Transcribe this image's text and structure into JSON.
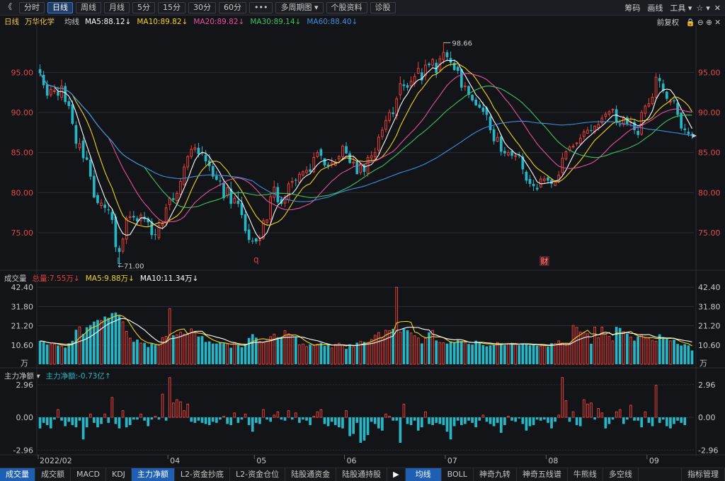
{
  "toolbar": {
    "back_glyph": "《",
    "tabs": [
      {
        "label": "分时",
        "active": false
      },
      {
        "label": "日线",
        "active": true
      },
      {
        "label": "周线",
        "active": false
      },
      {
        "label": "月线",
        "active": false
      },
      {
        "label": "5分",
        "active": false
      },
      {
        "label": "15分",
        "active": false
      },
      {
        "label": "30分",
        "active": false
      },
      {
        "label": "60分",
        "active": false
      },
      {
        "label": "•••",
        "active": false
      },
      {
        "label": "多周期图 ▾",
        "active": false
      },
      {
        "label": "个股资料",
        "active": false
      },
      {
        "label": "诊股",
        "active": false
      }
    ],
    "right": {
      "chips": "筹码",
      "draw": "画线",
      "tools": "工具 ▾",
      "star": "☆",
      "menu": "▾",
      "close": "✕"
    }
  },
  "price_legend": {
    "period": "日线",
    "stock": "万华化学",
    "ma_label": "均线",
    "ma5": "MA5:88.12↓",
    "ma10": "MA10:89.82↓",
    "ma20": "MA20:89.82↓",
    "ma30": "MA30:89.14↓",
    "ma60": "MA60:88.40↓",
    "adjust": "前复权",
    "icons": "🔒 ⊖ ⊕ ✕"
  },
  "volume_legend": {
    "title": "成交量",
    "total": "总量:7.55万↓",
    "ma5": "MA5:9.88万↓",
    "ma10": "MA10:11.34万↓"
  },
  "flow_legend": {
    "title": "主力净额 ▾",
    "value": "主力净额:-0.73亿↑"
  },
  "colors": {
    "up": "#e8403a",
    "down": "#27b6c6",
    "ma5": "#ffffff",
    "ma10": "#f2d21b",
    "ma20": "#e84f9e",
    "ma30": "#3cc25e",
    "ma60": "#3d8ee0",
    "axis": "#e04a45",
    "grid": "#2a2d33"
  },
  "chart_data": [
    {
      "type": "candlestick",
      "title": "万华化学 日线",
      "y_ticks": [
        95.0,
        90.0,
        85.0,
        80.0,
        75.0
      ],
      "y_tick_labels": [
        "95.00",
        "90.00",
        "85.00",
        "80.00",
        "75.00"
      ],
      "ylim": [
        70.5,
        100.5
      ],
      "annotations": {
        "high": "98.66",
        "low": "←71.00",
        "mark_L": "L",
        "mark_q": "q",
        "mark_cai": "财"
      },
      "x_tick_labels": [
        "2022/02",
        "04",
        "05",
        "06",
        "07",
        "08",
        "09"
      ],
      "x_tick_index": [
        0,
        36,
        60,
        85,
        113,
        141,
        169
      ],
      "ma_names": [
        "MA5",
        "MA10",
        "MA20",
        "MA30",
        "MA60"
      ],
      "close": [
        94.9,
        93.4,
        92.1,
        92.9,
        92.7,
        92.1,
        93.3,
        91.3,
        90.8,
        88.6,
        86.1,
        86.1,
        84.3,
        84.1,
        82.0,
        79.4,
        78.7,
        78.7,
        78.1,
        77.8,
        76.6,
        73.2,
        72.6,
        74.2,
        76.8,
        77.0,
        76.9,
        76.4,
        77.2,
        76.7,
        76.3,
        74.7,
        74.7,
        75.9,
        76.1,
        78.1,
        79.3,
        79.1,
        79.9,
        81.4,
        83.2,
        84.5,
        85.4,
        85.6,
        84.8,
        84.9,
        83.9,
        83.3,
        82.0,
        81.6,
        81.4,
        79.3,
        80.6,
        78.6,
        79.3,
        78.6,
        77.2,
        75.2,
        74.1,
        73.9,
        73.9,
        74.1,
        76.5,
        76.6,
        79.5,
        80.7,
        78.8,
        78.6,
        79.4,
        81.1,
        81.4,
        81.5,
        82.3,
        82.6,
        82.8,
        82.6,
        84.4,
        85.0,
        84.6,
        83.4,
        83.3,
        83.7,
        83.8,
        84.5,
        85.8,
        84.9,
        83.7,
        83.8,
        82.3,
        83.6,
        82.6,
        84.4,
        84.6,
        85.0,
        86.9,
        87.8,
        89.0,
        90.0,
        89.8,
        91.7,
        93.6,
        93.3,
        93.1,
        93.9,
        94.5,
        95.5,
        94.0,
        95.9,
        95.9,
        96.6,
        94.9,
        96.7,
        97.5,
        96.9,
        96.2,
        95.3,
        95.2,
        93.1,
        93.3,
        92.2,
        91.5,
        90.9,
        90.6,
        90.1,
        89.7,
        87.8,
        86.4,
        86.9,
        85.1,
        84.9,
        85.0,
        84.6,
        84.6,
        84.6,
        82.9,
        81.5,
        81.1,
        80.8,
        80.4,
        81.7,
        81.7,
        81.5,
        81.1,
        81.3,
        82.2,
        84.3,
        85.1,
        85.7,
        85.8,
        86.2,
        86.8,
        87.6,
        87.8,
        87.7,
        88.3,
        88.5,
        89.3,
        89.8,
        90.1,
        90.4,
        88.8,
        88.4,
        89.3,
        88.6,
        88.8,
        87.8,
        87.2,
        90.0,
        90.8,
        91.1,
        91.9,
        94.4,
        93.9,
        92.7,
        91.7,
        91.4,
        91.4,
        89.7,
        88.0,
        87.8,
        87.3,
        87.1
      ],
      "open": [
        95.4,
        94.7,
        93.5,
        92.2,
        92.7,
        92.6,
        91.9,
        93.3,
        91.4,
        91.0,
        88.4,
        85.6,
        86.5,
        84.4,
        84.1,
        82.1,
        79.7,
        78.4,
        78.5,
        77.9,
        77.6,
        77.0,
        73.1,
        72.7,
        74.2,
        76.9,
        77.1,
        76.8,
        76.5,
        77.0,
        76.8,
        76.4,
        74.8,
        74.4,
        75.9,
        76.3,
        78.5,
        79.3,
        79.0,
        79.8,
        81.0,
        83.2,
        84.5,
        85.4,
        85.6,
        85.0,
        84.7,
        84.0,
        83.3,
        82.1,
        81.5,
        81.2,
        79.6,
        80.5,
        78.7,
        79.0,
        78.7,
        77.3,
        75.4,
        74.0,
        74.3,
        74.1,
        74.3,
        76.3,
        76.7,
        79.4,
        80.7,
        79.2,
        78.7,
        79.1,
        81.3,
        81.6,
        81.3,
        82.2,
        82.5,
        82.9,
        82.6,
        84.5,
        85.4,
        84.3,
        83.5,
        83.5,
        83.4,
        84.2,
        84.5,
        85.8,
        84.9,
        83.7,
        83.9,
        82.5,
        83.5,
        82.4,
        84.3,
        84.5,
        85.3,
        87.0,
        87.9,
        89.0,
        90.0,
        89.6,
        92.2,
        93.5,
        93.4,
        93.3,
        93.6,
        94.9,
        95.0,
        94.6,
        96.1,
        95.9,
        96.2,
        95.3,
        96.6,
        97.5,
        96.8,
        96.2,
        95.7,
        95.4,
        93.2,
        93.3,
        92.2,
        91.6,
        91.0,
        90.6,
        90.6,
        89.5,
        87.9,
        86.4,
        87.0,
        85.2,
        84.7,
        85.2,
        84.6,
        84.7,
        84.5,
        82.6,
        81.7,
        81.1,
        80.6,
        80.7,
        81.5,
        81.9,
        81.6,
        80.9,
        81.4,
        82.5,
        84.2,
        85.3,
        85.7,
        86.2,
        86.1,
        87.0,
        87.4,
        87.8,
        87.6,
        88.1,
        88.7,
        89.5,
        89.8,
        90.3,
        90.4,
        88.5,
        88.5,
        89.4,
        88.8,
        88.8,
        87.7,
        87.3,
        89.9,
        90.8,
        91.1,
        91.9,
        94.3,
        93.6,
        92.6,
        91.3,
        91.5,
        91.2,
        90.0,
        88.0,
        87.6,
        87.3
      ],
      "high": [
        96.0,
        95.2,
        94.0,
        93.3,
        93.5,
        93.2,
        94.1,
        93.7,
        91.8,
        91.5,
        88.9,
        86.8,
        86.9,
        85.2,
        84.5,
        82.8,
        80.0,
        79.2,
        79.1,
        78.7,
        78.0,
        77.4,
        73.4,
        74.4,
        77.1,
        77.7,
        77.7,
        77.1,
        77.5,
        77.6,
        77.0,
        76.8,
        75.5,
        76.6,
        76.4,
        78.6,
        79.5,
        80.0,
        80.2,
        81.8,
        83.6,
        84.7,
        85.9,
        86.1,
        86.2,
        85.8,
        85.3,
        84.8,
        84.0,
        82.7,
        82.1,
        81.7,
        81.1,
        81.4,
        79.6,
        80.2,
        79.5,
        77.7,
        76.1,
        74.4,
        74.4,
        74.8,
        76.8,
        76.7,
        79.9,
        81.5,
        81.2,
        79.5,
        79.7,
        81.4,
        81.9,
        81.8,
        82.6,
        82.8,
        83.3,
        83.6,
        85.0,
        85.3,
        85.6,
        84.3,
        83.8,
        84.4,
        84.2,
        84.7,
        86.0,
        86.3,
        85.2,
        84.6,
        84.0,
        83.7,
        83.6,
        84.7,
        85.2,
        85.6,
        87.3,
        88.2,
        89.6,
        90.4,
        90.7,
        92.0,
        94.5,
        94.1,
        93.7,
        94.5,
        94.9,
        96.3,
        95.5,
        96.6,
        96.3,
        96.8,
        96.6,
        97.1,
        98.7,
        97.8,
        97.6,
        96.6,
        95.9,
        95.5,
        93.8,
        93.4,
        92.3,
        91.9,
        91.4,
        91.3,
        90.8,
        89.7,
        88.3,
        87.5,
        87.3,
        85.7,
        85.3,
        85.4,
        85.0,
        85.1,
        84.9,
        82.8,
        82.2,
        81.6,
        81.1,
        82.1,
        82.1,
        82.2,
        81.8,
        81.5,
        82.7,
        85.0,
        85.3,
        85.9,
        86.1,
        86.3,
        87.3,
        87.9,
        88.2,
        88.5,
        88.4,
        89.0,
        89.7,
        90.1,
        90.3,
        90.5,
        90.9,
        89.1,
        89.6,
        89.6,
        89.5,
        89.2,
        88.2,
        90.3,
        91.0,
        91.8,
        92.4,
        94.9,
        94.8,
        94.1,
        92.7,
        91.7,
        91.8,
        91.7,
        90.0,
        88.6,
        88.1,
        87.6
      ],
      "low": [
        94.5,
        93.0,
        91.7,
        91.9,
        92.3,
        91.5,
        91.5,
        91.0,
        90.4,
        88.4,
        85.5,
        85.2,
        83.8,
        84.0,
        81.6,
        79.3,
        78.5,
        78.0,
        77.5,
        77.3,
        76.1,
        72.6,
        71.0,
        72.4,
        73.6,
        76.6,
        76.5,
        76.0,
        76.0,
        76.3,
        75.8,
        74.2,
        74.1,
        74.1,
        75.4,
        75.9,
        77.8,
        78.8,
        78.5,
        79.4,
        80.8,
        82.8,
        84.2,
        85.1,
        84.4,
        84.6,
        83.4,
        82.7,
        81.7,
        81.5,
        80.8,
        79.0,
        79.3,
        78.0,
        78.6,
        78.2,
        76.8,
        74.9,
        73.7,
        73.6,
        73.6,
        73.4,
        74.1,
        75.9,
        76.0,
        78.9,
        78.6,
        78.3,
        78.2,
        78.7,
        80.6,
        80.8,
        81.2,
        82.0,
        82.3,
        82.3,
        82.4,
        84.3,
        84.1,
        83.2,
        82.9,
        83.1,
        83.3,
        83.7,
        84.0,
        84.8,
        83.6,
        83.2,
        82.3,
        82.2,
        82.1,
        82.0,
        83.9,
        84.1,
        84.8,
        86.6,
        87.5,
        88.7,
        89.4,
        89.1,
        91.6,
        92.7,
        92.7,
        93.0,
        93.2,
        94.8,
        93.5,
        94.0,
        95.6,
        95.5,
        94.3,
        95.2,
        96.1,
        96.4,
        95.8,
        95.2,
        94.8,
        92.7,
        92.7,
        91.8,
        91.3,
        90.8,
        90.5,
        89.7,
        89.0,
        87.4,
        86.0,
        86.3,
        84.6,
        84.5,
        84.5,
        84.2,
        84.0,
        84.3,
        82.3,
        81.1,
        80.7,
        80.2,
        80.2,
        80.6,
        81.1,
        81.1,
        80.6,
        80.8,
        81.2,
        82.1,
        84.0,
        85.1,
        85.5,
        85.8,
        85.9,
        86.6,
        87.5,
        87.5,
        87.3,
        87.7,
        88.4,
        89.1,
        89.5,
        89.9,
        88.4,
        88.2,
        88.2,
        88.3,
        88.2,
        87.3,
        86.8,
        87.1,
        89.4,
        90.6,
        90.9,
        91.6,
        93.1,
        92.4,
        91.4,
        90.9,
        91.1,
        89.4,
        87.7,
        87.3,
        87.0,
        86.7
      ]
    },
    {
      "type": "bar",
      "title": "成交量",
      "unit": "万",
      "y_ticks": [
        42.4,
        31.8,
        21.2,
        10.6
      ],
      "y_tick_labels": [
        "42.40",
        "31.80",
        "21.20",
        "10.60"
      ],
      "ylim": [
        0,
        44
      ],
      "values": [
        12.8,
        12.5,
        10.9,
        10.9,
        11.1,
        10.3,
        10.0,
        9.2,
        11.5,
        12.9,
        19.0,
        20.6,
        16.7,
        20.4,
        21.6,
        23.5,
        24.4,
        24.1,
        26.3,
        25.6,
        28.2,
        28.5,
        26.7,
        23.4,
        18.1,
        14.4,
        12.4,
        13.6,
        11.7,
        11.8,
        9.5,
        11.4,
        10.7,
        10.3,
        14.7,
        15.4,
        30.6,
        16.0,
        16.2,
        17.7,
        16.6,
        17.1,
        19.5,
        17.4,
        15.3,
        15.5,
        12.3,
        12.6,
        11.4,
        11.4,
        12.2,
        11.6,
        11.0,
        9.1,
        12.0,
        10.6,
        9.4,
        11.0,
        14.5,
        16.6,
        14.7,
        12.6,
        11.9,
        12.8,
        15.2,
        16.6,
        14.9,
        14.6,
        18.5,
        16.8,
        15.8,
        14.9,
        10.7,
        11.2,
        9.8,
        11.0,
        10.3,
        11.1,
        11.8,
        10.1,
        10.9,
        9.0,
        10.9,
        11.6,
        10.6,
        8.5,
        11.0,
        9.7,
        11.9,
        12.6,
        12.3,
        12.0,
        13.7,
        16.0,
        17.5,
        14.6,
        18.7,
        18.5,
        19.5,
        42.4,
        17.8,
        19.6,
        18.7,
        17.2,
        15.7,
        14.5,
        11.5,
        14.3,
        17.6,
        18.6,
        13.1,
        12.0,
        11.9,
        11.4,
        12.6,
        11.9,
        13.3,
        12.8,
        12.1,
        11.2,
        10.9,
        13.0,
        12.2,
        10.6,
        9.9,
        10.4,
        10.9,
        12.0,
        11.5,
        10.6,
        11.4,
        11.8,
        11.5,
        10.6,
        11.3,
        10.9,
        10.4,
        11.1,
        10.3,
        10.0,
        10.2,
        9.7,
        11.6,
        11.5,
        12.9,
        11.7,
        10.4,
        11.2,
        21.4,
        20.3,
        17.8,
        17.4,
        16.8,
        11.3,
        20.5,
        14.7,
        20.5,
        16.6,
        15.4,
        12.9,
        20.6,
        20.0,
        18.0,
        16.9,
        15.0,
        13.0,
        15.3,
        16.2,
        14.4,
        14.4,
        13.2,
        12.7,
        16.5,
        15.0,
        14.1,
        12.9,
        13.6,
        11.2,
        10.3,
        11.1,
        10.4,
        7.6
      ],
      "ma_names": [
        "MA5",
        "MA10"
      ]
    },
    {
      "type": "bar",
      "title": "主力净额",
      "unit": "亿",
      "y_ticks": [
        2.96,
        0.0,
        -2.96
      ],
      "y_tick_labels": [
        "2.96",
        "0.00",
        "-2.96"
      ],
      "ylim": [
        -3.2,
        3.2
      ],
      "values": [
        -1.0,
        -0.5,
        -0.7,
        -1.0,
        -0.2,
        0.7,
        -0.3,
        -0.8,
        -0.4,
        -0.7,
        -0.9,
        -0.3,
        -2.0,
        -0.9,
        0.3,
        -0.5,
        -0.9,
        -0.6,
        0.3,
        -0.5,
        1.8,
        -0.6,
        -1.0,
        0.6,
        -0.9,
        -0.7,
        -0.2,
        -0.2,
        0.3,
        -0.3,
        -0.8,
        -0.2,
        0.1,
        -0.2,
        2.1,
        -0.3,
        3.6,
        1.3,
        1.6,
        1.4,
        0.6,
        1.2,
        -0.4,
        -0.5,
        -0.3,
        -0.5,
        -0.6,
        -0.7,
        -0.4,
        -0.5,
        -0.2,
        0.1,
        -0.6,
        -0.7,
        0.4,
        -0.5,
        -0.2,
        0.3,
        -0.7,
        -1.3,
        -0.5,
        -0.6,
        0.7,
        -0.2,
        -0.4,
        0.2,
        0.5,
        -0.2,
        -0.3,
        0.6,
        -0.2,
        0.4,
        -0.5,
        -0.2,
        -0.3,
        -0.7,
        0.1,
        0.5,
        0.7,
        -0.6,
        -0.8,
        -0.4,
        -0.7,
        -0.9,
        -1.0,
        0.6,
        -1.7,
        -1.5,
        -0.5,
        -2.3,
        -2.1,
        -1.6,
        -0.4,
        -0.6,
        -1.0,
        -1.2,
        0.3,
        0.1,
        -0.3,
        -0.3,
        -2.3,
        1.2,
        -0.6,
        -0.7,
        -0.3,
        -1.2,
        -0.9,
        0.5,
        -0.6,
        -0.7,
        -0.5,
        -0.6,
        -0.7,
        -1.3,
        -2.0,
        -0.8,
        -0.3,
        -0.7,
        -0.6,
        -0.3,
        -0.5,
        -0.9,
        -0.3,
        0.2,
        -0.4,
        -0.6,
        -0.8,
        -0.5,
        -1.4,
        -0.7,
        0.1,
        -0.3,
        -0.4,
        -0.1,
        -0.6,
        -1.2,
        -0.8,
        -0.7,
        -0.2,
        -0.3,
        -0.2,
        -0.5,
        -1.0,
        -0.4,
        0.2,
        3.6,
        1.5,
        -0.4,
        0.5,
        -0.7,
        -0.8,
        1.6,
        1.2,
        1.3,
        -0.2,
        0.8,
        0.4,
        -1.0,
        -0.6,
        -0.2,
        0.5,
        0.7,
        -0.6,
        -0.2,
        1.1,
        -0.3,
        -0.3,
        -0.9,
        0.5,
        -0.5,
        -0.8,
        2.9,
        -0.5,
        -0.2,
        -0.8,
        -1.0,
        -0.6,
        -0.3,
        -0.5,
        -0.7
      ]
    }
  ],
  "bottom_tabs": {
    "left": [
      {
        "label": "成交量",
        "active": true
      },
      {
        "label": "成交额",
        "active": false
      },
      {
        "label": "MACD",
        "active": false
      },
      {
        "label": "KDJ",
        "active": false
      },
      {
        "label": "主力净额",
        "active": true
      },
      {
        "label": "L2-资金抄底",
        "active": false
      },
      {
        "label": "L2-资金仓位",
        "active": false
      },
      {
        "label": "陆股通资金",
        "active": false
      },
      {
        "label": "陆股通持股",
        "active": false
      }
    ],
    "arrow": "▶",
    "right": [
      {
        "label": "均线",
        "active": true
      },
      {
        "label": "BOLL",
        "active": false
      },
      {
        "label": "神奇九转",
        "active": false
      },
      {
        "label": "神奇五线谱",
        "active": false
      },
      {
        "label": "牛熊线",
        "active": false
      },
      {
        "label": "多空线",
        "active": false
      }
    ],
    "manage": "指标管理"
  }
}
